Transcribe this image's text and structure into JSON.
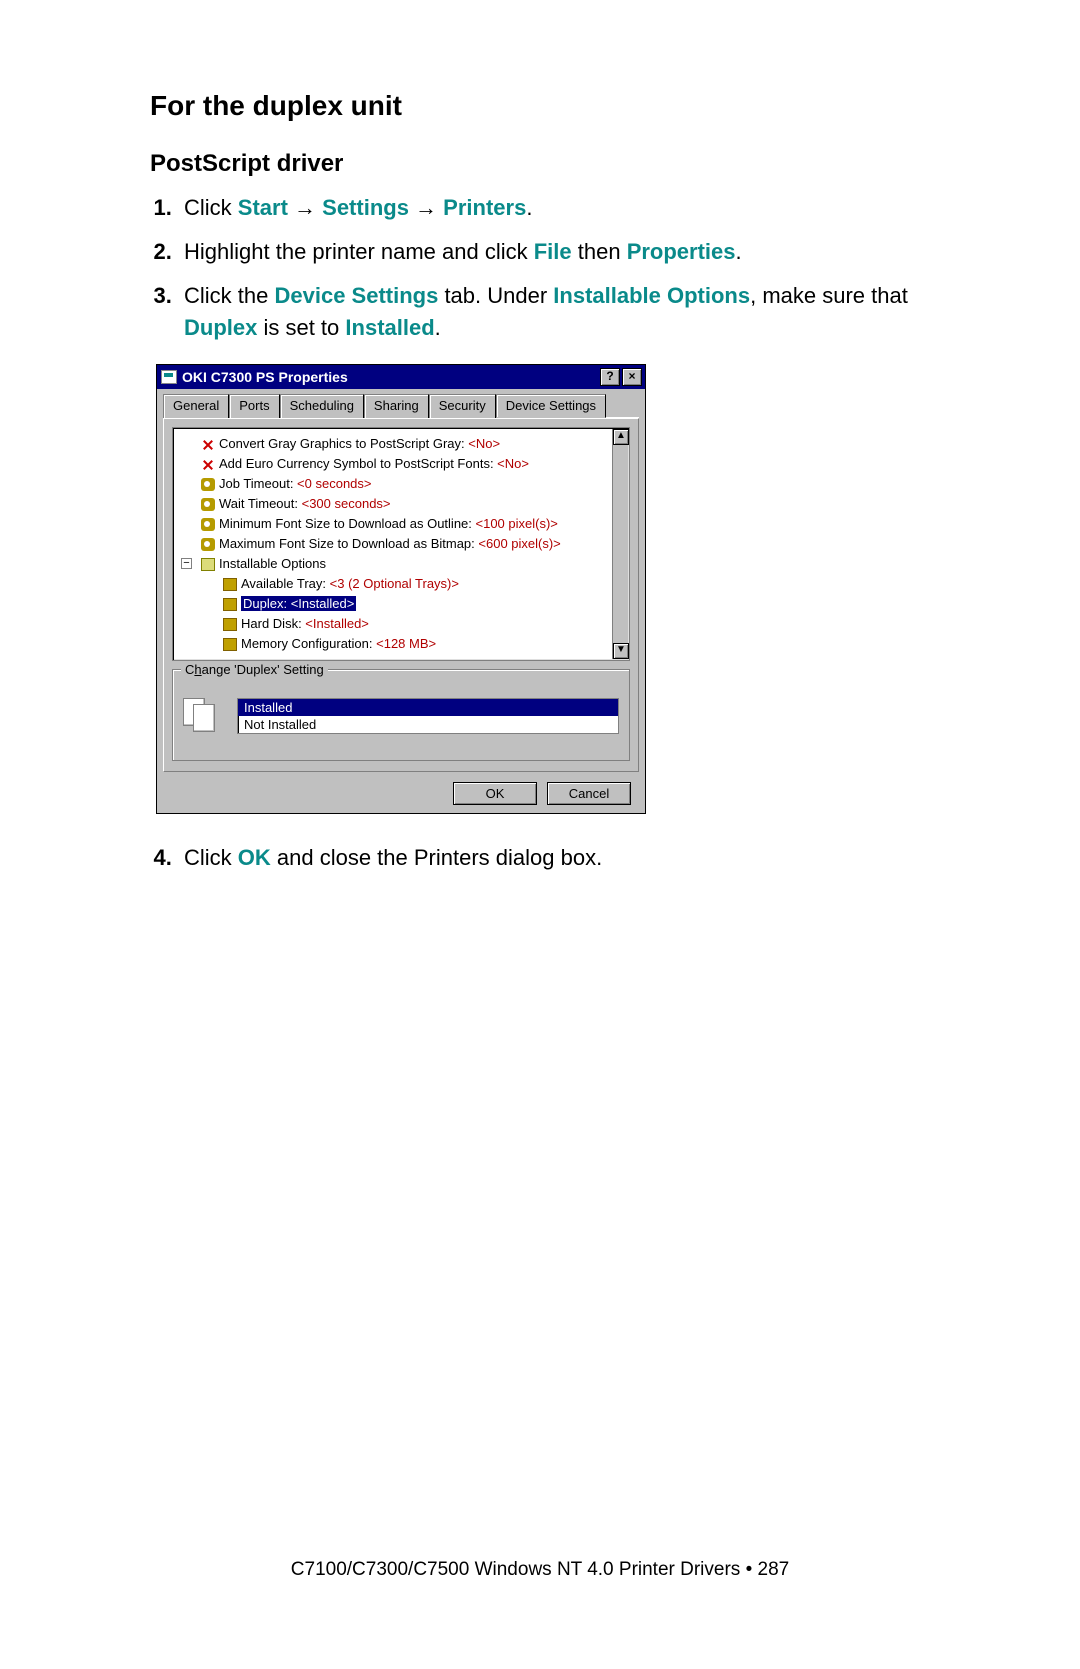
{
  "headings": {
    "section": "For the duplex unit",
    "subsection": "PostScript driver"
  },
  "steps": {
    "s1": {
      "prefix": "Click ",
      "a": "Start",
      "arrow1": " → ",
      "b": "Settings",
      "arrow2": " → ",
      "c": "Printers",
      "suffix": "."
    },
    "s2": {
      "prefix": "Highlight the printer name and click ",
      "a": "File",
      "mid": " then ",
      "b": "Properties",
      "suffix": "."
    },
    "s3": {
      "prefix": "Click the ",
      "a": "Device Settings",
      "mid1": " tab. Under ",
      "b": "Installable Options",
      "mid2": ", make sure that ",
      "c": "Duplex",
      "mid3": " is set to ",
      "d": "Installed",
      "suffix": "."
    },
    "s4": {
      "prefix": "Click ",
      "a": "OK",
      "suffix": " and close the Printers dialog box."
    }
  },
  "dialog": {
    "title": "OKI C7300 PS Properties",
    "help_btn": "?",
    "close_btn": "×",
    "tabs": [
      "General",
      "Ports",
      "Scheduling",
      "Sharing",
      "Security",
      "Device Settings"
    ],
    "active_tab": "Device Settings",
    "tree": {
      "row0": {
        "label": "Convert Gray Graphics to PostScript Gray: ",
        "value": "<No>"
      },
      "row1": {
        "label": "Add Euro Currency Symbol to PostScript Fonts: ",
        "value": "<No>"
      },
      "row2": {
        "label": "Job Timeout: ",
        "value": "<0 seconds>"
      },
      "row3": {
        "label": "Wait Timeout: ",
        "value": "<300 seconds>"
      },
      "row4": {
        "label": "Minimum Font Size to Download as Outline: ",
        "value": "<100 pixel(s)>"
      },
      "row5": {
        "label": "Maximum Font Size to Download as Bitmap: ",
        "value": "<600 pixel(s)>"
      },
      "group": {
        "expander": "−",
        "label": "Installable Options"
      },
      "row6": {
        "label": "Available Tray: ",
        "value": "<3 (2 Optional Trays)>"
      },
      "row7": {
        "label": "Duplex: ",
        "value": "<Installed>"
      },
      "row8": {
        "label": "Hard Disk: ",
        "value": "<Installed>"
      },
      "row9": {
        "label": "Memory Configuration: ",
        "value": "<128 MB>"
      }
    },
    "change_group": {
      "legend_pre": "C",
      "legend_u": "h",
      "legend_post": "ange 'Duplex' Setting",
      "options": [
        "Installed",
        "Not Installed"
      ]
    },
    "buttons": {
      "ok": "OK",
      "cancel": "Cancel"
    },
    "scroll": {
      "up": "▲",
      "down": "▼"
    }
  },
  "footer": "C7100/C7300/C7500 Windows NT 4.0 Printer Drivers • 287"
}
